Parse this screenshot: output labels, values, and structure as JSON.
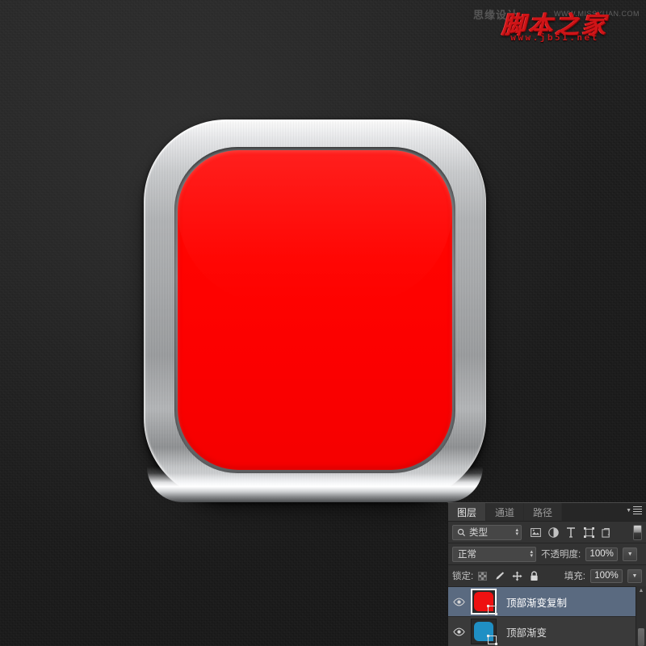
{
  "watermark": {
    "ghost_text": "思缘设计",
    "ghost_url": "WWW.MISSYUAN.COM",
    "main_text": "脚本之家",
    "url_text": "www.jb51.net",
    "main_color": "#cf1417"
  },
  "icon": {
    "name": "metal-bezel-red-app-icon",
    "face_color": "#FF0000",
    "bezel_color": "#a6a8aa"
  },
  "panel": {
    "tabs": [
      {
        "label": "图层",
        "active": true
      },
      {
        "label": "通道",
        "active": false
      },
      {
        "label": "路径",
        "active": false
      }
    ],
    "menu_icon": "panel-menu-icon",
    "filter": {
      "search_icon": "search-icon",
      "type_label": "类型",
      "icons": [
        "pixel-layer-filter-icon",
        "adjustment-layer-filter-icon",
        "type-layer-filter-icon",
        "shape-layer-filter-icon",
        "smart-object-filter-icon"
      ],
      "toggle": "filter-enable-toggle"
    },
    "blend": {
      "mode": "正常",
      "opacity_label": "不透明度:",
      "opacity_value": "100%"
    },
    "lock": {
      "label": "锁定:",
      "icons": [
        "lock-transparent-pixels-icon",
        "lock-image-pixels-icon",
        "lock-position-icon",
        "lock-all-icon"
      ],
      "fill_label": "填充:",
      "fill_value": "100%"
    },
    "layers": [
      {
        "name": "顶部渐变复制",
        "visible": true,
        "selected": true,
        "thumb_color": "#ee1111",
        "eye_icon": "eye-icon",
        "badge_icon": "vector-mask-badge-icon"
      },
      {
        "name": "顶部渐变",
        "visible": true,
        "selected": false,
        "thumb_color": "#1f8fc4",
        "eye_icon": "eye-icon",
        "badge_icon": "vector-mask-badge-icon"
      }
    ],
    "scroll": {
      "up_arrow": "scroll-up-arrow-icon",
      "thumb": "scrollbar-thumb"
    }
  }
}
